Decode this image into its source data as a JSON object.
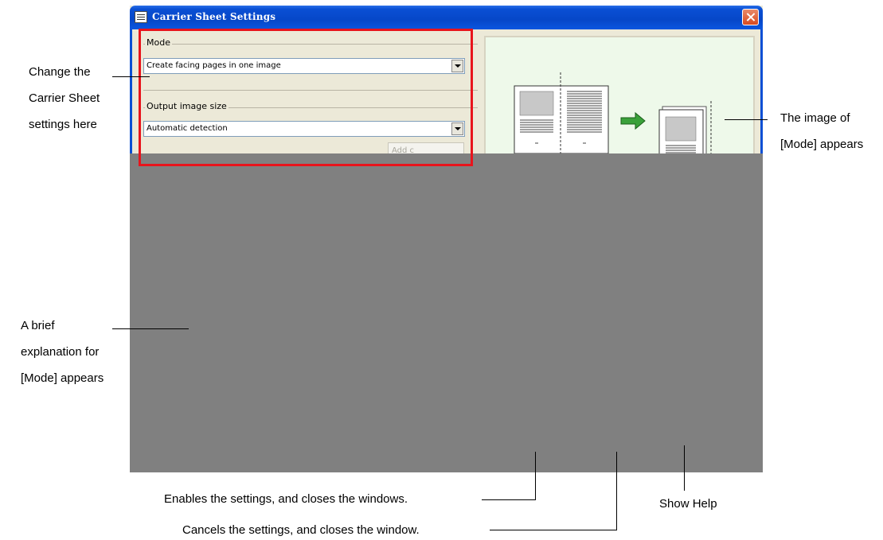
{
  "window": {
    "title": "Carrier Sheet Settings",
    "mode_group_label": "Mode",
    "mode_value": "Create facing pages in one image",
    "output_size_group_label": "Output image size",
    "output_size_value": "Automatic detection",
    "add_button_label": "Add c"
  },
  "annotations": {
    "change_settings": [
      "Change the",
      "Carrier Sheet",
      "settings here"
    ],
    "image_of_mode": [
      "The image of",
      "[Mode] appears"
    ],
    "brief_explanation": [
      "A brief",
      "explanation for",
      "[Mode] appears"
    ],
    "ok_desc": "Enables the settings, and closes the windows.",
    "cancel_desc": "Cancels the settings, and closes the window.",
    "help_desc": "Show Help"
  },
  "colors": {
    "highlight_box": "#e8141c",
    "masked_area": "#808080",
    "preview_background": "#eef9ea",
    "arrow": "#3aa13a"
  }
}
